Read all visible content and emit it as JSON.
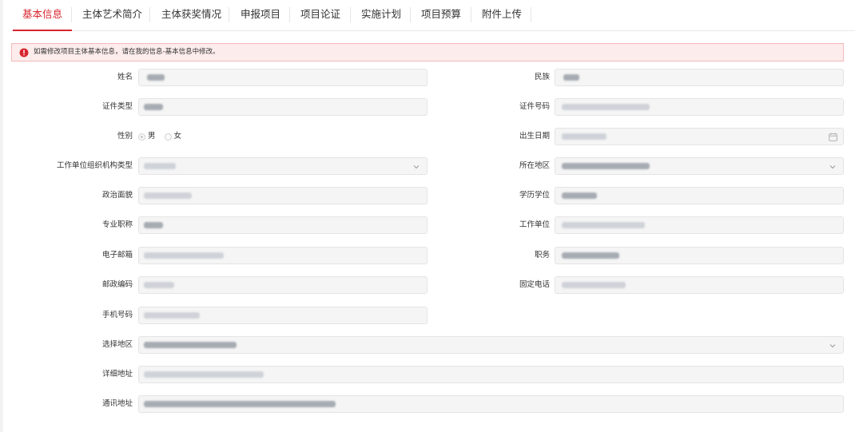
{
  "tabs": [
    {
      "label": "基本信息",
      "active": true
    },
    {
      "label": "主体艺术简介",
      "active": false
    },
    {
      "label": "主体获奖情况",
      "active": false
    },
    {
      "label": "申报项目",
      "active": false
    },
    {
      "label": "项目论证",
      "active": false
    },
    {
      "label": "实施计划",
      "active": false
    },
    {
      "label": "项目预算",
      "active": false
    },
    {
      "label": "附件上传",
      "active": false
    }
  ],
  "alert": {
    "icon": "error-circle-icon",
    "message": "如需修改项目主体基本信息，请在我的信息-基本信息中修改。",
    "color": "#d8262f"
  },
  "form": {
    "name_label": "姓名",
    "ethnicity_label": "民族",
    "id_type_label": "证件类型",
    "id_number_label": "证件号码",
    "gender_label": "性别",
    "gender_options": [
      "男",
      "女"
    ],
    "gender_selected": "男",
    "birth_date_label": "出生日期",
    "employer_org_type_label": "工作单位组织机构类型",
    "region_label": "所在地区",
    "political_status_label": "政治面貌",
    "education_label": "学历学位",
    "professional_title_label": "专业职称",
    "employer_label": "工作单位",
    "email_label": "电子邮箱",
    "position_label": "职务",
    "postal_code_label": "邮政编码",
    "landline_label": "固定电话",
    "mobile_label": "手机号码",
    "select_region_label": "选择地区",
    "detail_address_label": "详细地址",
    "mailing_address_label": "通讯地址"
  },
  "colors": {
    "accent": "#d8262f",
    "field_bg": "#f5f5f5",
    "alert_bg": "#fdecec"
  }
}
